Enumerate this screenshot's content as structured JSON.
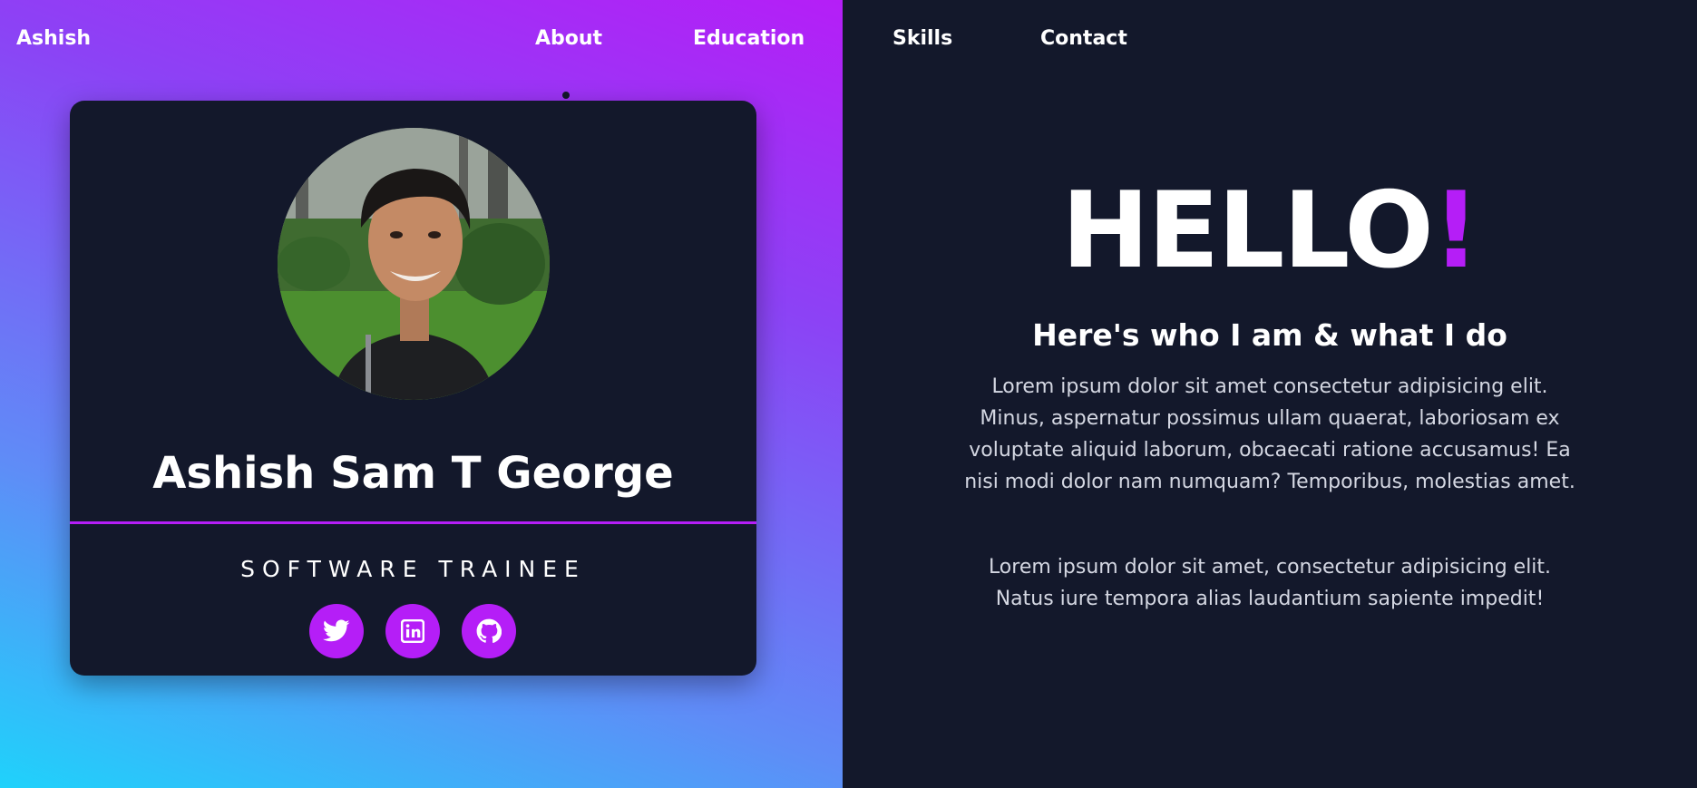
{
  "brand": "Ashish",
  "nav": {
    "items": [
      "About",
      "Education",
      "Skills",
      "Contact"
    ],
    "active": "About"
  },
  "profile": {
    "name": "Ashish Sam T George",
    "role": "SOFTWARE TRAINEE",
    "socials": [
      "twitter-icon",
      "linkedin-icon",
      "github-icon"
    ]
  },
  "hero": {
    "greeting": "HELLO",
    "exclamation": "!",
    "subheading": "Here's who I am & what I do",
    "paragraph1": "Lorem ipsum dolor sit amet consectetur adipisicing elit. Minus, aspernatur possimus ullam quaerat, laboriosam ex voluptate aliquid laborum, obcaecati ratione accusamus! Ea nisi modi dolor nam numquam? Temporibus, molestias amet.",
    "paragraph2": "Lorem ipsum dolor sit amet, consectetur adipisicing elit. Natus iure tempora alias laudantium sapiente impedit!"
  },
  "colors": {
    "accent": "#b51ef7",
    "background": "#13182b",
    "gradient_top": "#b51ef7",
    "gradient_bottom": "#1fd2fb"
  }
}
